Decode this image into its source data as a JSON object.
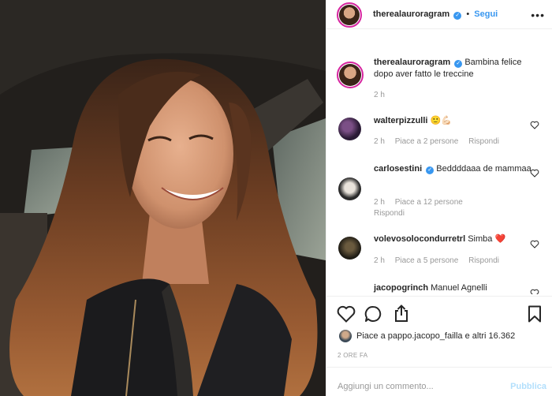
{
  "post": {
    "username": "therealauroragram",
    "follow_label": "Segui",
    "dot": "•",
    "more_label": "•••",
    "caption": "Bambina felice dopo aver fatto le treccine",
    "caption_time": "2 h"
  },
  "comments": [
    {
      "username": "walterpizzulli",
      "text": "🙂💪🏻",
      "time": "2 h",
      "likes": "Piace a 2 persone",
      "reply": "Rispondi",
      "verified": false
    },
    {
      "username": "carlosestini",
      "text": "Beddddaaa de mammaa",
      "time": "2 h",
      "likes": "Piace a 12 persone",
      "reply": "Rispondi",
      "verified": true
    },
    {
      "username": "volevosolocondurretrl",
      "text": "Simba ❤️",
      "time": "2 h",
      "likes": "Piace a 5 persone",
      "reply": "Rispondi",
      "verified": false
    },
    {
      "username": "jacopogrinch",
      "text": "Manuel Agnelli",
      "time": "",
      "likes": "",
      "reply": "",
      "verified": false
    }
  ],
  "actions": {
    "likes_text": "Piace a pappo.jacopo_failla e altri 16.362",
    "date": "2 ORE FA"
  },
  "comment_box": {
    "placeholder": "Aggiungi un commento...",
    "publish": "Pubblica"
  },
  "colors": {
    "accent": "#3897f0",
    "border": "#efefef",
    "muted": "#999999",
    "heart": "#ed4956"
  }
}
